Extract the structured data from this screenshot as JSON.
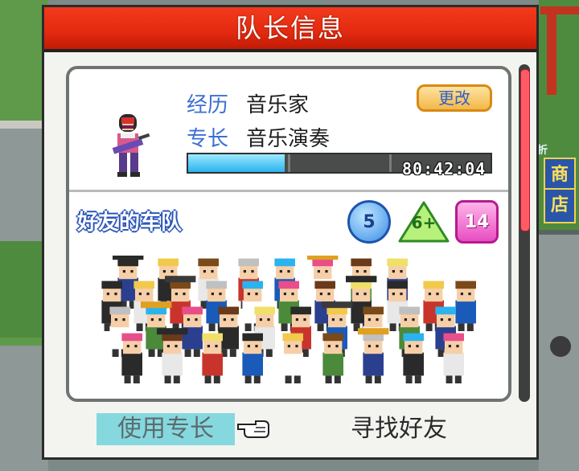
{
  "modal": {
    "title": "队长信息"
  },
  "leader": {
    "career_label": "经历",
    "career_value": "音乐家",
    "specialty_label": "专长",
    "specialty_value": "音乐演奏",
    "change_button": "更改",
    "timer": "80:42:04",
    "progress_fraction": 0.32
  },
  "friends": {
    "title": "好友的车队",
    "badges": {
      "circle": "5",
      "triangle": "6+",
      "square": "14"
    }
  },
  "actions": {
    "use_skill": "使用专长",
    "find_friends": "寻找好友"
  },
  "world": {
    "shop_top": "折",
    "shop_sign_1": "商",
    "shop_sign_2": "店"
  },
  "colors": {
    "title_red": "#e32a10",
    "label_blue": "#3d6fd6",
    "progress_fill": "#2ab3ee",
    "scroll_thumb": "#ff5a65",
    "skill_highlight": "#86d8df"
  },
  "icons": [
    "hand-pointer-icon",
    "leader-musician-icon",
    "friend-crowd-icon"
  ]
}
